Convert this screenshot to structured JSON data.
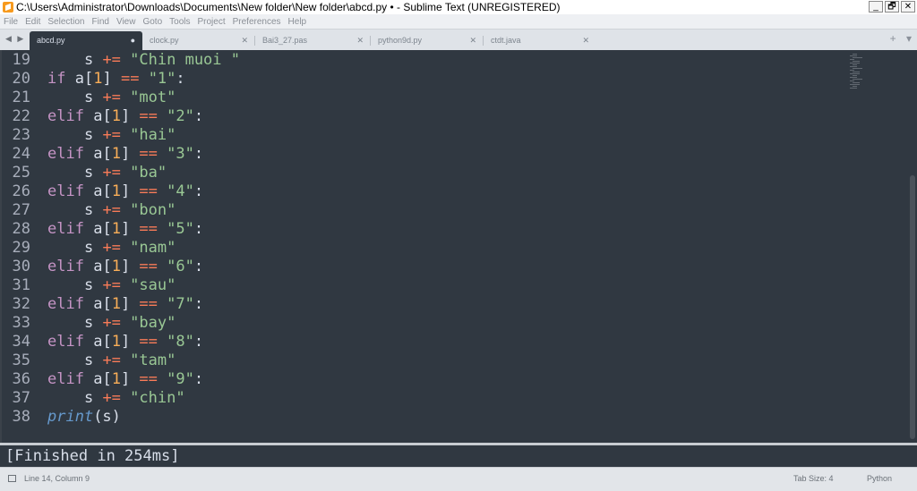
{
  "window": {
    "title": "C:\\Users\\Administrator\\Downloads\\Documents\\New folder\\New folder\\abcd.py • - Sublime Text (UNREGISTERED)",
    "minimize_glyph": "_",
    "maximize_glyph": "🗗",
    "close_glyph": "✕"
  },
  "menu": [
    "File",
    "Edit",
    "Selection",
    "Find",
    "View",
    "Goto",
    "Tools",
    "Project",
    "Preferences",
    "Help"
  ],
  "tabbar": {
    "nav_arrows": "◀ ▶",
    "new_tab_glyph": "+",
    "tab_list_glyph": "▾",
    "tabs": [
      {
        "label": "abcd.py",
        "close": "●",
        "active": true
      },
      {
        "label": "clock.py",
        "close": "✕",
        "active": false
      },
      {
        "label": "Bai3_27.pas",
        "close": "✕",
        "active": false
      },
      {
        "label": "python9d.py",
        "close": "✕",
        "active": false
      },
      {
        "label": "ctdt.java",
        "close": "✕",
        "active": false
      }
    ]
  },
  "editor": {
    "lines": [
      {
        "n": "19",
        "indent": "    ",
        "tokens": [
          [
            "s",
            ""
          ],
          [
            " +=",
            "op"
          ],
          [
            " ",
            ""
          ],
          [
            "\"Chin muoi \"",
            "str"
          ]
        ]
      },
      {
        "n": "20",
        "indent": "",
        "tokens": [
          [
            "if",
            "kw"
          ],
          [
            " a",
            ""
          ],
          [
            "[",
            ""
          ],
          [
            "1",
            "num"
          ],
          [
            "]",
            ""
          ],
          [
            " ==",
            "op"
          ],
          [
            " ",
            ""
          ],
          [
            "\"1\"",
            "str"
          ],
          [
            ":",
            ""
          ]
        ]
      },
      {
        "n": "21",
        "indent": "    ",
        "tokens": [
          [
            "s",
            ""
          ],
          [
            " +=",
            "op"
          ],
          [
            " ",
            ""
          ],
          [
            "\"mot\"",
            "str"
          ]
        ]
      },
      {
        "n": "22",
        "indent": "",
        "tokens": [
          [
            "elif",
            "kw"
          ],
          [
            " a",
            ""
          ],
          [
            "[",
            ""
          ],
          [
            "1",
            "num"
          ],
          [
            "]",
            ""
          ],
          [
            " ==",
            "op"
          ],
          [
            " ",
            ""
          ],
          [
            "\"2\"",
            "str"
          ],
          [
            ":",
            ""
          ]
        ]
      },
      {
        "n": "23",
        "indent": "    ",
        "tokens": [
          [
            "s",
            ""
          ],
          [
            " +=",
            "op"
          ],
          [
            " ",
            ""
          ],
          [
            "\"hai\"",
            "str"
          ]
        ]
      },
      {
        "n": "24",
        "indent": "",
        "tokens": [
          [
            "elif",
            "kw"
          ],
          [
            " a",
            ""
          ],
          [
            "[",
            ""
          ],
          [
            "1",
            "num"
          ],
          [
            "]",
            ""
          ],
          [
            " ==",
            "op"
          ],
          [
            " ",
            ""
          ],
          [
            "\"3\"",
            "str"
          ],
          [
            ":",
            ""
          ]
        ]
      },
      {
        "n": "25",
        "indent": "    ",
        "tokens": [
          [
            "s",
            ""
          ],
          [
            " +=",
            "op"
          ],
          [
            " ",
            ""
          ],
          [
            "\"ba\"",
            "str"
          ]
        ]
      },
      {
        "n": "26",
        "indent": "",
        "tokens": [
          [
            "elif",
            "kw"
          ],
          [
            " a",
            ""
          ],
          [
            "[",
            ""
          ],
          [
            "1",
            "num"
          ],
          [
            "]",
            ""
          ],
          [
            " ==",
            "op"
          ],
          [
            " ",
            ""
          ],
          [
            "\"4\"",
            "str"
          ],
          [
            ":",
            ""
          ]
        ]
      },
      {
        "n": "27",
        "indent": "    ",
        "tokens": [
          [
            "s",
            ""
          ],
          [
            " +=",
            "op"
          ],
          [
            " ",
            ""
          ],
          [
            "\"bon\"",
            "str"
          ]
        ]
      },
      {
        "n": "28",
        "indent": "",
        "tokens": [
          [
            "elif",
            "kw"
          ],
          [
            " a",
            ""
          ],
          [
            "[",
            ""
          ],
          [
            "1",
            "num"
          ],
          [
            "]",
            ""
          ],
          [
            " ==",
            "op"
          ],
          [
            " ",
            ""
          ],
          [
            "\"5\"",
            "str"
          ],
          [
            ":",
            ""
          ]
        ]
      },
      {
        "n": "29",
        "indent": "    ",
        "tokens": [
          [
            "s",
            ""
          ],
          [
            " +=",
            "op"
          ],
          [
            " ",
            ""
          ],
          [
            "\"nam\"",
            "str"
          ]
        ]
      },
      {
        "n": "30",
        "indent": "",
        "tokens": [
          [
            "elif",
            "kw"
          ],
          [
            " a",
            ""
          ],
          [
            "[",
            ""
          ],
          [
            "1",
            "num"
          ],
          [
            "]",
            ""
          ],
          [
            " ==",
            "op"
          ],
          [
            " ",
            ""
          ],
          [
            "\"6\"",
            "str"
          ],
          [
            ":",
            ""
          ]
        ]
      },
      {
        "n": "31",
        "indent": "    ",
        "tokens": [
          [
            "s",
            ""
          ],
          [
            " +=",
            "op"
          ],
          [
            " ",
            ""
          ],
          [
            "\"sau\"",
            "str"
          ]
        ]
      },
      {
        "n": "32",
        "indent": "",
        "tokens": [
          [
            "elif",
            "kw"
          ],
          [
            " a",
            ""
          ],
          [
            "[",
            ""
          ],
          [
            "1",
            "num"
          ],
          [
            "]",
            ""
          ],
          [
            " ==",
            "op"
          ],
          [
            " ",
            ""
          ],
          [
            "\"7\"",
            "str"
          ],
          [
            ":",
            ""
          ]
        ]
      },
      {
        "n": "33",
        "indent": "    ",
        "tokens": [
          [
            "s",
            ""
          ],
          [
            " +=",
            "op"
          ],
          [
            " ",
            ""
          ],
          [
            "\"bay\"",
            "str"
          ]
        ]
      },
      {
        "n": "34",
        "indent": "",
        "tokens": [
          [
            "elif",
            "kw"
          ],
          [
            " a",
            ""
          ],
          [
            "[",
            ""
          ],
          [
            "1",
            "num"
          ],
          [
            "]",
            ""
          ],
          [
            " ==",
            "op"
          ],
          [
            " ",
            ""
          ],
          [
            "\"8\"",
            "str"
          ],
          [
            ":",
            ""
          ]
        ]
      },
      {
        "n": "35",
        "indent": "    ",
        "tokens": [
          [
            "s",
            ""
          ],
          [
            " +=",
            "op"
          ],
          [
            " ",
            ""
          ],
          [
            "\"tam\"",
            "str"
          ]
        ]
      },
      {
        "n": "36",
        "indent": "",
        "tokens": [
          [
            "elif",
            "kw"
          ],
          [
            " a",
            ""
          ],
          [
            "[",
            ""
          ],
          [
            "1",
            "num"
          ],
          [
            "]",
            ""
          ],
          [
            " ==",
            "op"
          ],
          [
            " ",
            ""
          ],
          [
            "\"9\"",
            "str"
          ],
          [
            ":",
            ""
          ]
        ]
      },
      {
        "n": "37",
        "indent": "    ",
        "tokens": [
          [
            "s",
            ""
          ],
          [
            " +=",
            "op"
          ],
          [
            " ",
            ""
          ],
          [
            "\"chin\"",
            "str"
          ]
        ]
      },
      {
        "n": "38",
        "indent": "",
        "tokens": [
          [
            "print",
            "fn"
          ],
          [
            "(s)",
            ""
          ]
        ]
      }
    ]
  },
  "output": {
    "text": "[Finished in 254ms]"
  },
  "status": {
    "position": "Line 14, Column 9",
    "tab_size": "Tab Size: 4",
    "syntax": "Python"
  },
  "colors": {
    "editor_bg": "#303841",
    "keyword": "#c594c5",
    "operator": "#f97b58",
    "string": "#99c794",
    "number": "#f9ae58",
    "function": "#6699cc",
    "text": "#d8dee9"
  }
}
